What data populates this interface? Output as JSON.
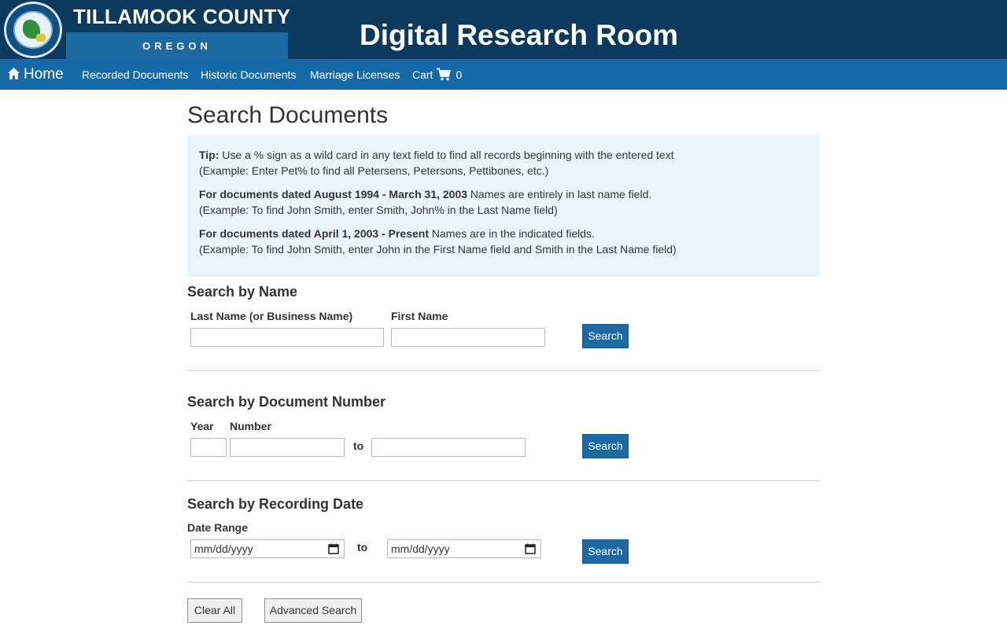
{
  "header": {
    "brand_title": "TILLAMOOK COUNTY",
    "brand_state": "OREGON",
    "seal_text": "TILLAMOOK COUNTY",
    "site_title": "Digital Research Room"
  },
  "nav": {
    "home": "Home",
    "items": [
      "Recorded Documents",
      "Historic Documents",
      "Marriage Licenses"
    ],
    "cart_label": "Cart",
    "cart_count": "0"
  },
  "page": {
    "title": "Search Documents"
  },
  "tips": {
    "tip_bold": "Tip:",
    "tip_text": " Use a % sign as a wild card in any text field to find all records beginning with the entered text",
    "tip_example": "(Example: Enter Pet% to find all Petersens, Petersons, Pettibones, etc.)",
    "range1_bold": "For documents dated August 1994 - March 31, 2003",
    "range1_text": " Names are entirely in last name field.",
    "range1_example": "(Example: To find John Smith, enter Smith, John% in the Last Name field)",
    "range2_bold": "For documents dated April 1, 2003 - Present",
    "range2_text": " Names are in the indicated fields.",
    "range2_example": "(Example: To find John Smith, enter John in the First Name field and Smith in the Last Name field)"
  },
  "search_name": {
    "title": "Search by Name",
    "last_label": "Last Name (or Business Name)",
    "first_label": "First Name",
    "last_value": "",
    "first_value": "",
    "button": "Search"
  },
  "search_number": {
    "title": "Search by Document Number",
    "year_label": "Year",
    "number_label": "Number",
    "to_label": "to",
    "year_value": "",
    "from_value": "",
    "to_value": "",
    "button": "Search"
  },
  "search_date": {
    "title": "Search by Recording Date",
    "range_label": "Date Range",
    "from_placeholder": "mm/dd/yyyy",
    "to_label": "to",
    "to_placeholder": "mm/dd/yyyy",
    "button": "Search"
  },
  "footer_buttons": {
    "clear": "Clear All",
    "advanced": "Advanced Search"
  },
  "colors": {
    "header_bg": "#0b3a5e",
    "nav_bg": "#1669a7",
    "primary": "#1d6aa3",
    "tip_bg": "#e9f4fd"
  }
}
